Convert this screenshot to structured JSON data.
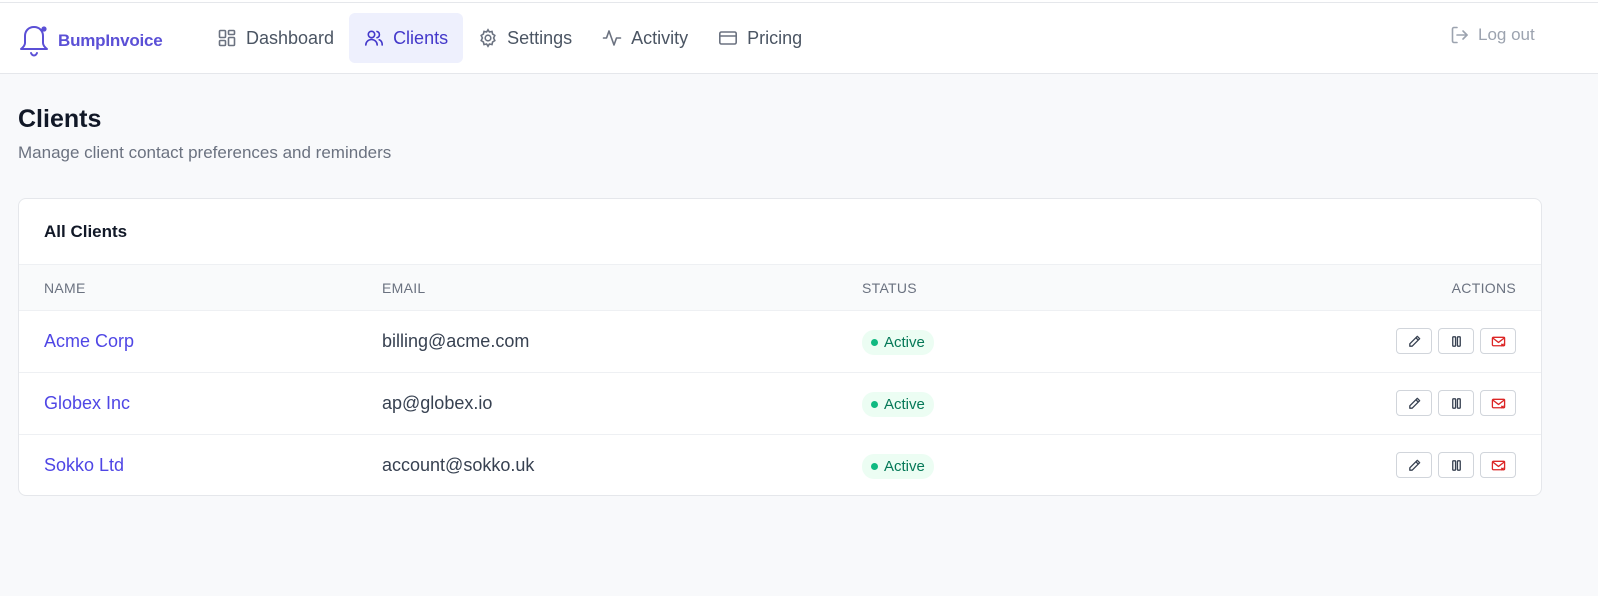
{
  "app": {
    "name": "BumpInvoice"
  },
  "nav": {
    "items": [
      {
        "label": "Dashboard",
        "icon": "dashboard-icon",
        "active": false
      },
      {
        "label": "Clients",
        "icon": "users-icon",
        "active": true
      },
      {
        "label": "Settings",
        "icon": "gear-icon",
        "active": false
      },
      {
        "label": "Activity",
        "icon": "activity-icon",
        "active": false
      },
      {
        "label": "Pricing",
        "icon": "credit-card-icon",
        "active": false
      }
    ],
    "logout_label": "Log out"
  },
  "page": {
    "title": "Clients",
    "subtitle": "Manage client contact preferences and reminders"
  },
  "table": {
    "title": "All Clients",
    "columns": {
      "name": "NAME",
      "email": "EMAIL",
      "status": "STATUS",
      "actions": "ACTIONS"
    },
    "rows": [
      {
        "name": "Acme Corp",
        "email": "billing@acme.com",
        "status": "Active"
      },
      {
        "name": "Globex Inc",
        "email": "ap@globex.io",
        "status": "Active"
      },
      {
        "name": "Sokko Ltd",
        "email": "account@sokko.uk",
        "status": "Active"
      }
    ],
    "action_icons": [
      "edit-icon",
      "pause-icon",
      "mail-off-icon"
    ]
  },
  "colors": {
    "brand": "#5b50d6",
    "active_nav_bg": "#eef0fd",
    "link": "#4f46e5",
    "status_active_bg": "#ecfdf3",
    "status_active_text": "#047857",
    "danger": "#dc2626"
  }
}
